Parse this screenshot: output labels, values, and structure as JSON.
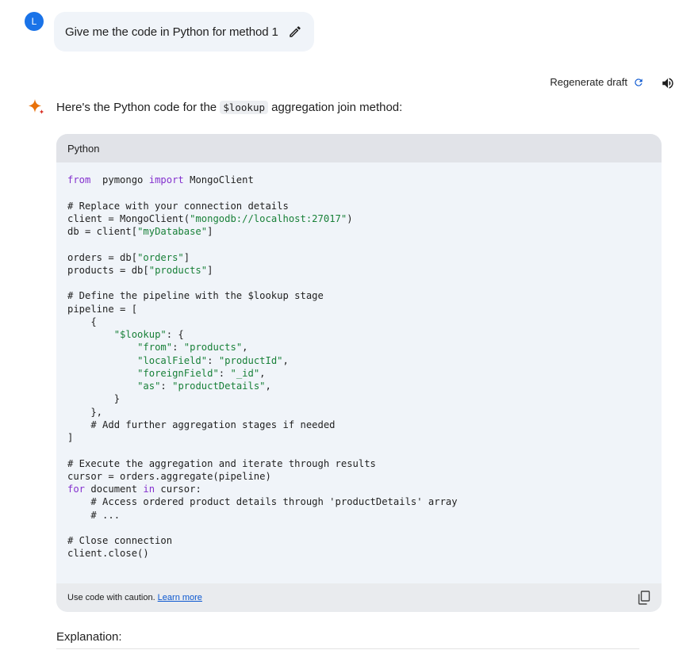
{
  "user": {
    "avatar_letter": "L",
    "prompt": "Give me the code in Python for method 1"
  },
  "response": {
    "regenerate_label": "Regenerate draft",
    "intro_before": "Here's the Python code for the ",
    "intro_code": "$lookup",
    "intro_after": " aggregation join method:",
    "code_language": "Python",
    "code_lines": [
      [
        [
          "kw",
          "from"
        ],
        [
          "",
          "  pymongo "
        ],
        [
          "kw",
          "import"
        ],
        [
          "",
          " MongoClient"
        ]
      ],
      [],
      [
        [
          "",
          "# Replace with your connection details"
        ]
      ],
      [
        [
          "",
          "client = MongoClient("
        ],
        [
          "str",
          "\"mongodb://localhost:27017\""
        ],
        [
          "",
          ")"
        ]
      ],
      [
        [
          "",
          "db = client["
        ],
        [
          "str",
          "\"myDatabase\""
        ],
        [
          "",
          "]"
        ]
      ],
      [],
      [
        [
          "",
          "orders = db["
        ],
        [
          "str",
          "\"orders\""
        ],
        [
          "",
          "]"
        ]
      ],
      [
        [
          "",
          "products = db["
        ],
        [
          "str",
          "\"products\""
        ],
        [
          "",
          "]"
        ]
      ],
      [],
      [
        [
          "",
          "# Define the pipeline with the $lookup stage"
        ]
      ],
      [
        [
          "",
          "pipeline = ["
        ]
      ],
      [
        [
          "",
          "    {"
        ]
      ],
      [
        [
          "",
          "        "
        ],
        [
          "str",
          "\"$lookup\""
        ],
        [
          "",
          ": {"
        ]
      ],
      [
        [
          "",
          "            "
        ],
        [
          "str",
          "\"from\""
        ],
        [
          "",
          ": "
        ],
        [
          "str",
          "\"products\""
        ],
        [
          "",
          ","
        ]
      ],
      [
        [
          "",
          "            "
        ],
        [
          "str",
          "\"localField\""
        ],
        [
          "",
          ": "
        ],
        [
          "str",
          "\"productId\""
        ],
        [
          "",
          ","
        ]
      ],
      [
        [
          "",
          "            "
        ],
        [
          "str",
          "\"foreignField\""
        ],
        [
          "",
          ": "
        ],
        [
          "str",
          "\"_id\""
        ],
        [
          "",
          ","
        ]
      ],
      [
        [
          "",
          "            "
        ],
        [
          "str",
          "\"as\""
        ],
        [
          "",
          ": "
        ],
        [
          "str",
          "\"productDetails\""
        ],
        [
          "",
          ","
        ]
      ],
      [
        [
          "",
          "        }"
        ]
      ],
      [
        [
          "",
          "    },"
        ]
      ],
      [
        [
          "",
          "    # Add further aggregation stages if needed"
        ]
      ],
      [
        [
          "",
          "]"
        ]
      ],
      [],
      [
        [
          "",
          "# Execute the aggregation and iterate through results"
        ]
      ],
      [
        [
          "",
          "cursor = orders.aggregate(pipeline)"
        ]
      ],
      [
        [
          "kw",
          "for"
        ],
        [
          "",
          " document "
        ],
        [
          "kw",
          "in"
        ],
        [
          "",
          " cursor:"
        ]
      ],
      [
        [
          "",
          "    # Access ordered product details through 'productDetails' array"
        ]
      ],
      [
        [
          "",
          "    # ..."
        ]
      ],
      [],
      [
        [
          "",
          "# Close connection"
        ]
      ],
      [
        [
          "",
          "client.close()"
        ]
      ]
    ],
    "caution_text": "Use code with caution.",
    "learn_more": "Learn more",
    "explanation_heading": "Explanation:"
  },
  "icons": {
    "edit": "pencil-icon",
    "regenerate": "refresh-icon",
    "speaker": "speaker-icon",
    "spark": "gemini-spark-icon",
    "copy": "copy-icon"
  },
  "colors": {
    "accent": "#1a73e8",
    "keyword": "#8430ce",
    "string": "#188038",
    "link": "#0b57d0"
  }
}
